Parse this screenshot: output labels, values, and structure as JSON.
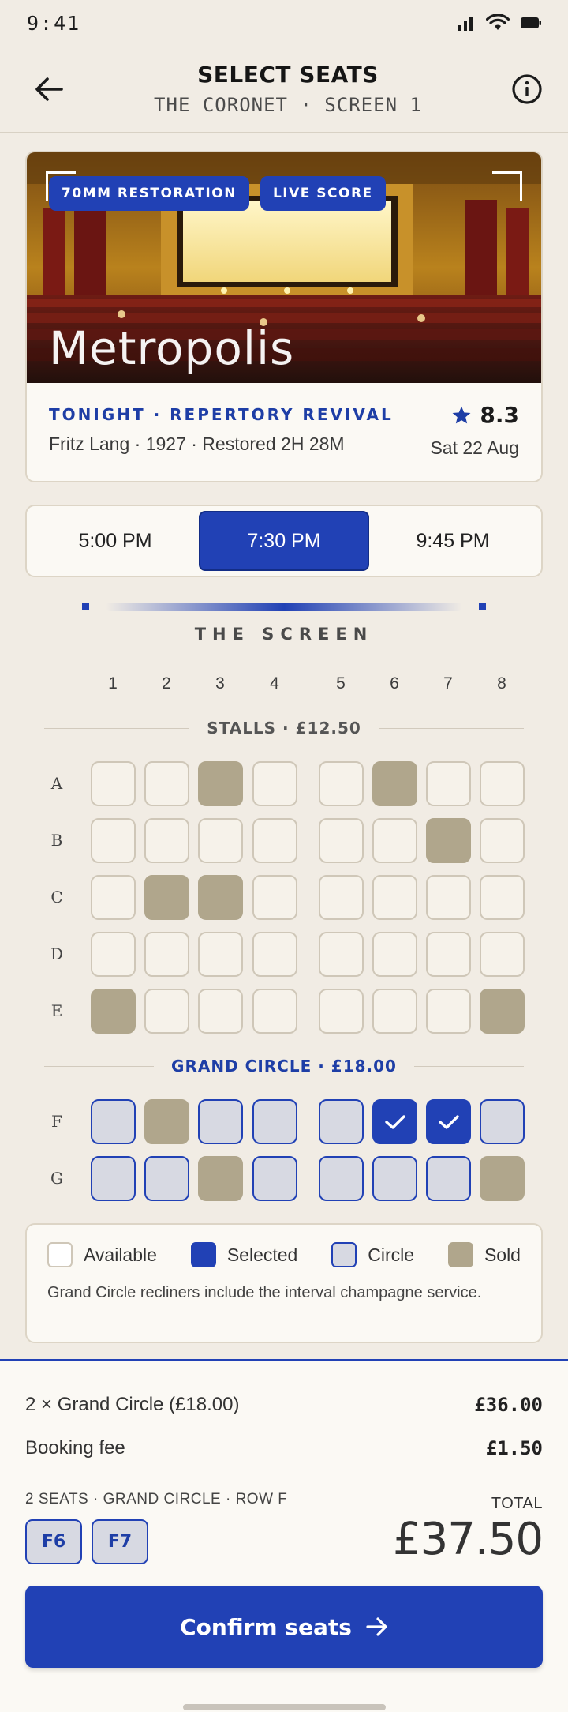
{
  "status_bar": {
    "time": "9:41"
  },
  "header": {
    "title": "SELECT SEATS",
    "subtitle": "THE CORONET · SCREEN 1",
    "back_icon": "arrow-left-icon",
    "info_icon": "info-icon"
  },
  "film": {
    "badges": [
      "70MM RESTORATION",
      "LIVE SCORE"
    ],
    "title": "Metropolis",
    "tag": "TONIGHT · REPERTORY REVIVAL",
    "meta": "Fritz Lang · 1927 · Restored 2H 28M",
    "rating": "8.3",
    "date": "Sat 22 Aug"
  },
  "showtimes": {
    "options": [
      "5:00 PM",
      "7:30 PM",
      "9:45 PM"
    ],
    "selected": "7:30 PM"
  },
  "screen_label": "THE SCREEN",
  "columns": [
    "1",
    "2",
    "3",
    "4",
    "5",
    "6",
    "7",
    "8"
  ],
  "sections": {
    "stalls": "STALLS · £12.50",
    "circle": "GRAND CIRCLE · £18.00"
  },
  "seat_map": {
    "rows": [
      {
        "label": "A",
        "type": "stalls",
        "sold": [
          3,
          6
        ],
        "selected": []
      },
      {
        "label": "B",
        "type": "stalls",
        "sold": [
          7
        ],
        "selected": []
      },
      {
        "label": "C",
        "type": "stalls",
        "sold": [
          2,
          3
        ],
        "selected": []
      },
      {
        "label": "D",
        "type": "stalls",
        "sold": [],
        "selected": []
      },
      {
        "label": "E",
        "type": "stalls",
        "sold": [
          1,
          8
        ],
        "selected": []
      },
      {
        "label": "F",
        "type": "circle",
        "sold": [
          2
        ],
        "selected": [
          6,
          7
        ]
      },
      {
        "label": "G",
        "type": "circle",
        "sold": [
          3,
          8
        ],
        "selected": []
      }
    ]
  },
  "legend": {
    "available": "Available",
    "selected": "Selected",
    "circle": "Circle",
    "sold": "Sold",
    "note": "Grand Circle recliners include the interval champagne service."
  },
  "summary": {
    "line_item_label": "2 × Grand Circle (£18.00)",
    "line_item_price": "£36.00",
    "fee_label": "Booking fee",
    "fee_price": "£1.50",
    "seats_caption": "2 SEATS · GRAND CIRCLE · ROW F",
    "seat_chips": [
      "F6",
      "F7"
    ],
    "total_label": "TOTAL",
    "total_value": "£37.50",
    "confirm_label": "Confirm seats"
  },
  "colors": {
    "accent": "#2141b5",
    "sold": "#b0a68c",
    "circle": "#d7d9e2",
    "background": "#f1ece4"
  }
}
